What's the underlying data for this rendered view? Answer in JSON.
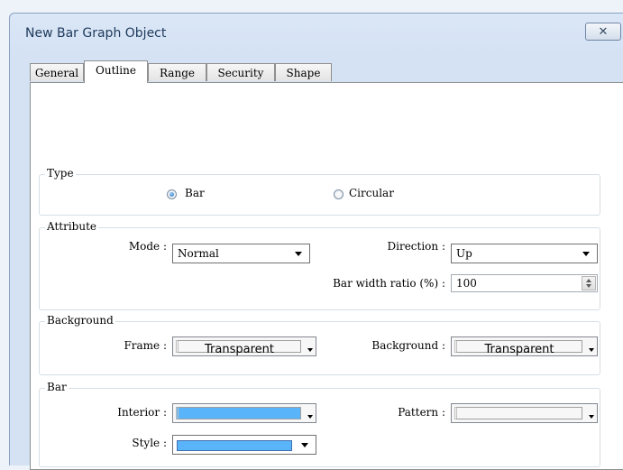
{
  "window": {
    "title": "New Bar Graph Object",
    "close_glyph": "✕"
  },
  "tabs": [
    {
      "label": "General"
    },
    {
      "label": "Outline"
    },
    {
      "label": "Range"
    },
    {
      "label": "Security"
    },
    {
      "label": "Shape"
    }
  ],
  "active_tab": "Outline",
  "type_group": {
    "legend": "Type",
    "options": [
      {
        "label": "Bar",
        "checked": true
      },
      {
        "label": "Circular",
        "checked": false
      }
    ]
  },
  "attribute_group": {
    "legend": "Attribute",
    "mode_label": "Mode :",
    "mode_value": "Normal",
    "direction_label": "Direction :",
    "direction_value": "Up",
    "bar_width_label": "Bar width ratio (%) :",
    "bar_width_value": "100"
  },
  "background_group": {
    "legend": "Background",
    "frame_label": "Frame :",
    "frame_value": "Transparent",
    "background_label": "Background :",
    "background_value": "Transparent"
  },
  "bar_group": {
    "legend": "Bar",
    "interior_label": "Interior :",
    "interior_color": "#5ab4fa",
    "pattern_label": "Pattern :",
    "style_label": "Style :",
    "style_color": "#5ab4fa"
  }
}
